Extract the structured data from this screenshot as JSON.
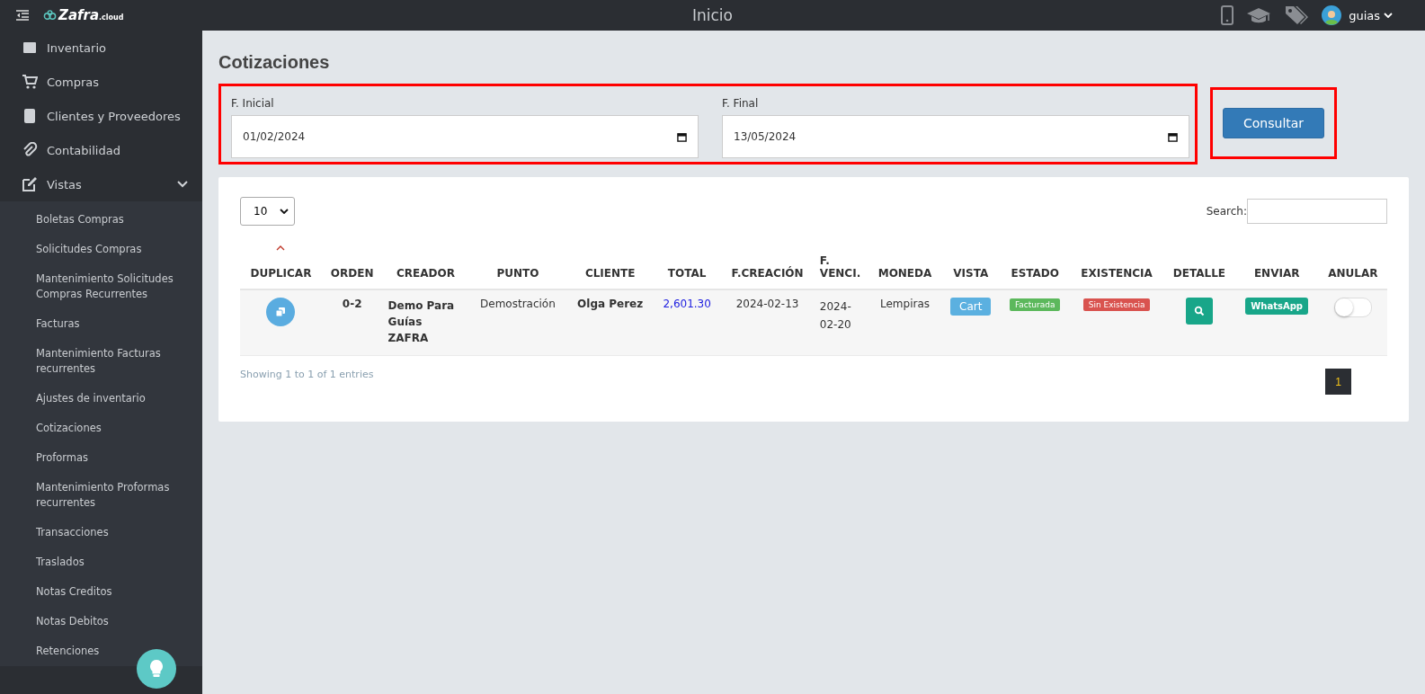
{
  "header": {
    "logo": {
      "name": "Zafra",
      "suffix": ".cloud"
    },
    "title": "Inicio",
    "user": "guias"
  },
  "sidebar": {
    "items": [
      {
        "label": "Inventario"
      },
      {
        "label": "Compras"
      },
      {
        "label": "Clientes y Proveedores"
      },
      {
        "label": "Contabilidad"
      },
      {
        "label": "Vistas",
        "expanded": true,
        "children": [
          {
            "label": "Boletas Compras"
          },
          {
            "label": "Solicitudes Compras"
          },
          {
            "label": "Mantenimiento Solicitudes Compras Recurrentes"
          },
          {
            "label": "Facturas"
          },
          {
            "label": "Mantenimiento Facturas recurrentes"
          },
          {
            "label": "Ajustes de inventario"
          },
          {
            "label": "Cotizaciones"
          },
          {
            "label": "Proformas"
          },
          {
            "label": "Mantenimiento Proformas recurrentes"
          },
          {
            "label": "Transacciones"
          },
          {
            "label": "Traslados"
          },
          {
            "label": "Notas Creditos"
          },
          {
            "label": "Notas Debitos"
          },
          {
            "label": "Retenciones"
          }
        ]
      }
    ]
  },
  "page": {
    "title": "Cotizaciones",
    "filters": [
      {
        "label": "F. Inicial",
        "value": "01/02/2024"
      },
      {
        "label": "F. Final",
        "value": "13/05/2024"
      }
    ],
    "submit": "Consultar"
  },
  "table": {
    "page_size": "10",
    "search_label": "Search:",
    "columns": [
      {
        "label": "DUPLICAR",
        "sorted": true
      },
      {
        "label": "ORDEN",
        "sorted": false
      },
      {
        "label": "CREADOR",
        "sorted": false
      },
      {
        "label": "PUNTO",
        "sorted": false
      },
      {
        "label": "CLIENTE",
        "sorted": false
      },
      {
        "label": "TOTAL",
        "sorted": false
      },
      {
        "label": "F.CREACIÓN",
        "sorted": false
      },
      {
        "label": "F. VENCI.",
        "sorted": false
      },
      {
        "label": "MONEDA",
        "sorted": false
      },
      {
        "label": "VISTA",
        "sorted": false
      },
      {
        "label": "ESTADO",
        "sorted": false
      },
      {
        "label": "EXISTENCIA",
        "sorted": false
      },
      {
        "label": "DETALLE",
        "sorted": false
      },
      {
        "label": "ENVIAR",
        "sorted": false
      },
      {
        "label": "ANULAR",
        "sorted": false
      }
    ],
    "rows": [
      {
        "orden": "0-2",
        "creador": "Demo Para Guías ZAFRA",
        "punto": "Demostración",
        "cliente": "Olga Perez",
        "total": "2,601.30",
        "creacion": "2024-02-13",
        "vencimiento": "2024-02-20",
        "moneda": "Lempiras",
        "vista": "Cart",
        "estado": "Facturada",
        "existencia": "Sin Existencia",
        "enviar": "WhatsApp",
        "anulado": false
      }
    ],
    "info": "Showing 1 to 1 of 1 entries",
    "pages": [
      {
        "label": "1",
        "selected": true
      }
    ]
  }
}
